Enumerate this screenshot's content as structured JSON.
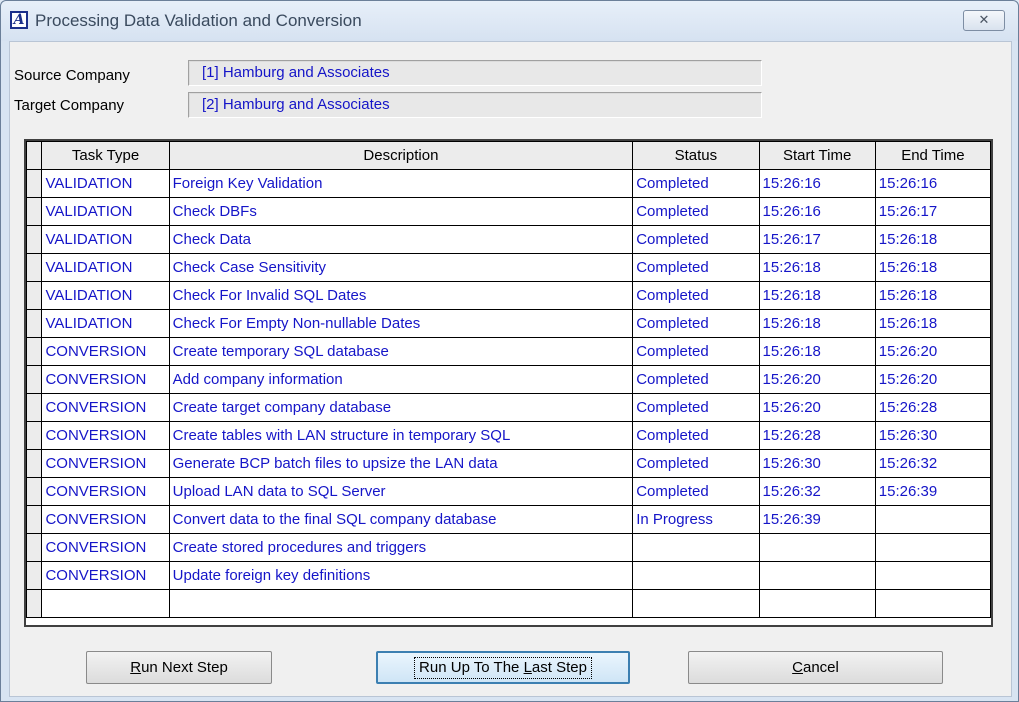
{
  "window": {
    "title": "Processing Data Validation and Conversion",
    "icon": "app-logo-icon",
    "close_glyph": "✕"
  },
  "form": {
    "source_label": "Source Company",
    "source_value": "[1] Hamburg and Associates",
    "target_label": "Target Company",
    "target_value": "[2] Hamburg and Associates"
  },
  "grid": {
    "columns": [
      "Task Type",
      "Description",
      "Status",
      "Start Time",
      "End Time"
    ],
    "rows": [
      [
        "VALIDATION",
        "Foreign Key Validation",
        "Completed",
        "15:26:16",
        "15:26:16"
      ],
      [
        "VALIDATION",
        "Check DBFs",
        "Completed",
        "15:26:16",
        "15:26:17"
      ],
      [
        "VALIDATION",
        "Check Data",
        "Completed",
        "15:26:17",
        "15:26:18"
      ],
      [
        "VALIDATION",
        "Check Case Sensitivity",
        "Completed",
        "15:26:18",
        "15:26:18"
      ],
      [
        "VALIDATION",
        "Check For Invalid SQL Dates",
        "Completed",
        "15:26:18",
        "15:26:18"
      ],
      [
        "VALIDATION",
        "Check For Empty Non-nullable Dates",
        "Completed",
        "15:26:18",
        "15:26:18"
      ],
      [
        "CONVERSION",
        "Create temporary SQL database",
        "Completed",
        "15:26:18",
        "15:26:20"
      ],
      [
        "CONVERSION",
        "Add company information",
        "Completed",
        "15:26:20",
        "15:26:20"
      ],
      [
        "CONVERSION",
        "Create target company database",
        "Completed",
        "15:26:20",
        "15:26:28"
      ],
      [
        "CONVERSION",
        "Create tables with LAN structure in temporary SQL",
        "Completed",
        "15:26:28",
        "15:26:30"
      ],
      [
        "CONVERSION",
        "Generate BCP batch files to upsize the LAN data",
        "Completed",
        "15:26:30",
        "15:26:32"
      ],
      [
        "CONVERSION",
        "Upload LAN data to SQL Server",
        "Completed",
        "15:26:32",
        "15:26:39"
      ],
      [
        "CONVERSION",
        "Convert data to the final SQL company database",
        "In Progress",
        "15:26:39",
        ""
      ],
      [
        "CONVERSION",
        "Create stored procedures and triggers",
        "",
        "",
        ""
      ],
      [
        "CONVERSION",
        "Update foreign key definitions",
        "",
        "",
        ""
      ],
      [
        "",
        "",
        "",
        "",
        ""
      ]
    ]
  },
  "buttons": {
    "run_next": {
      "pre": "",
      "key": "R",
      "post": "un Next Step"
    },
    "run_all": {
      "pre": "Run Up To The ",
      "key": "L",
      "post": "ast Step"
    },
    "cancel": {
      "pre": "",
      "key": "C",
      "post": "ancel"
    }
  },
  "colors": {
    "cell_text": "#1515c8",
    "focus_border": "#3c7fb1"
  }
}
